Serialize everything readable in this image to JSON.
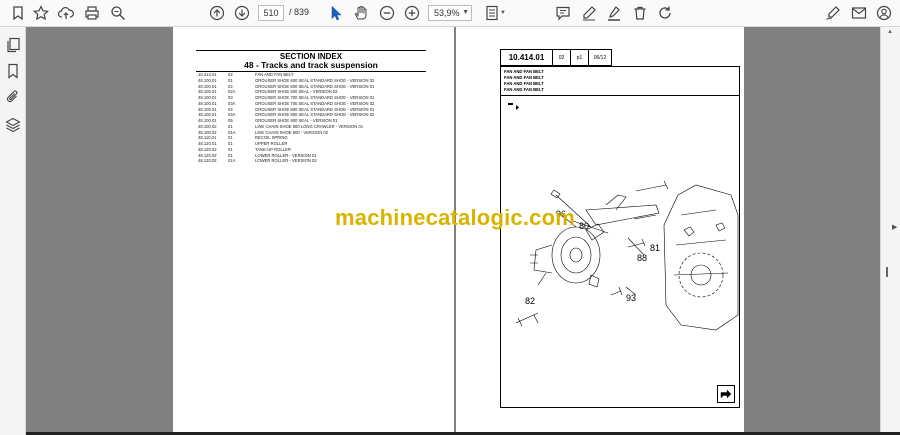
{
  "toolbar": {
    "icons": [
      "bookmark-icon",
      "star-icon",
      "cloud-upload-icon",
      "print-icon",
      "zoom-search-icon",
      "page-up-icon",
      "page-down-icon",
      "select-cursor-icon",
      "hand-icon",
      "zoom-out-icon",
      "zoom-in-icon",
      "fit-page-icon",
      "comment-icon",
      "pen-icon",
      "highlight-icon",
      "delete-icon",
      "rotate-icon",
      "sign-icon",
      "mail-icon",
      "account-icon"
    ],
    "page_current": "510",
    "page_total": "/ 839",
    "zoom": "53,9%"
  },
  "left_rail": {
    "icons": [
      "pages-icon",
      "bookmarks-icon",
      "attachments-icon",
      "layers-icon"
    ]
  },
  "left_page": {
    "title": "SECTION INDEX",
    "subtitle": "48 - Tracks and track suspension",
    "rows": [
      {
        "code": "10.414.01",
        "ver": "02",
        "desc": "FAN AND FAN BELT"
      },
      {
        "code": "48.100.01",
        "ver": "01",
        "desc": "GROUSER SHOE 600 SEAL STANDARD SHOE - VERSION 02"
      },
      {
        "code": "48.100.01",
        "ver": "02",
        "desc": "GROUSER SHOE 600 SEAL STANDARD SHOE - VERSION 01"
      },
      {
        "code": "48.100.01",
        "ver": "02A",
        "desc": "GROUSER SHOE 600 SEAL - VERSION 02"
      },
      {
        "code": "48.100.01",
        "ver": "03",
        "desc": "GROUSER SHOE 700 SEAL STANDARD SHOE - VERSION 01"
      },
      {
        "code": "48.100.01",
        "ver": "03A",
        "desc": "GROUSER SHOE 700 SEAL STANDARD SHOE - VERSION 02"
      },
      {
        "code": "48.100.01",
        "ver": "04",
        "desc": "GROUSER SHOE 800 SEAL STANDARD SHOE - VERSION 01"
      },
      {
        "code": "48.100.01",
        "ver": "04A",
        "desc": "GROUSER SHOE 800 SEAL STANDARD SHOE - VERSION 02"
      },
      {
        "code": "48.100.01",
        "ver": "05",
        "desc": "GROUSER SHOE 900 SEAL - VERSION 01"
      },
      {
        "code": "48.100.02",
        "ver": "01",
        "desc": "LINK CHAIN SHOE 600 LONG CRAWLER - VERSION 01"
      },
      {
        "code": "48.100.02",
        "ver": "01A",
        "desc": "LINK CHAIN SHOE 600 - VERSION 02"
      },
      {
        "code": "48.110.01",
        "ver": "01",
        "desc": "RECOIL SPRING"
      },
      {
        "code": "48.120.01",
        "ver": "01",
        "desc": "UPPER ROLLER"
      },
      {
        "code": "48.120.02",
        "ver": "01",
        "desc": "TANK-UP ROLLER"
      },
      {
        "code": "48.120.02",
        "ver": "01",
        "desc": "LOWER ROLLER - VERSION 01"
      },
      {
        "code": "48.120.02",
        "ver": "01A",
        "desc": "LOWER ROLLER - VERSION 02"
      }
    ]
  },
  "right_page": {
    "section_code": "10.414.01",
    "ver": "02",
    "page": "p1",
    "date": "06/12",
    "lines": [
      "FAN AND FAN BELT",
      "FAN AND FAN BELT",
      "FAN AND FAN BELT",
      "FAN AND FAN BELT"
    ],
    "callouts": [
      "96",
      "80",
      "81",
      "88",
      "82",
      "93"
    ]
  },
  "watermark": "machinecatalogic.com"
}
